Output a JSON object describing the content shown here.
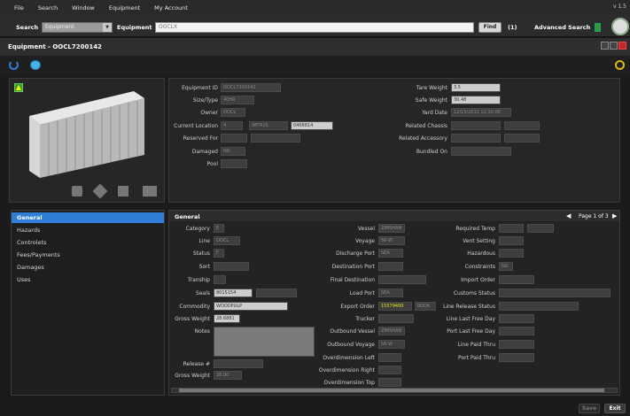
{
  "menu": {
    "items": [
      "File",
      "Search",
      "Window",
      "Equipment",
      "My Account"
    ],
    "version": "v 1.5"
  },
  "search": {
    "label": "Search",
    "type_value": "Equipment",
    "equipment_label": "Equipment",
    "query": "OOCLX",
    "find_label": "Find",
    "count": "(1)",
    "advanced_label": "Advanced Search"
  },
  "panel": {
    "title": "Equipment - OOCL7200142"
  },
  "equipment": {
    "fields": [
      {
        "label": "Equipment ID",
        "value": "OOCL7200142"
      },
      {
        "label": "Size/Type",
        "value": "40HR"
      },
      {
        "label": "Owner",
        "value": "OOCL"
      },
      {
        "label": "Current Location",
        "value": "4",
        "v2": "98TA15",
        "v3": "0468814"
      },
      {
        "label": "Reserved For",
        "value": ""
      },
      {
        "label": "Damaged",
        "value": "NO"
      },
      {
        "label": "Pool",
        "value": ""
      }
    ],
    "right_fields": [
      {
        "label": "Tare Weight",
        "value": "3.5"
      },
      {
        "label": "Safe Weight",
        "value": "30.48"
      },
      {
        "label": "Yard Date",
        "value": "12/15/2013 12:30:00"
      },
      {
        "label": "Related Chassis",
        "value": ""
      },
      {
        "label": "Related Accessory",
        "value": ""
      },
      {
        "label": "Bundled On",
        "value": ""
      }
    ]
  },
  "sidenav": {
    "items": [
      "General",
      "Hazards",
      "Controlets",
      "Fees/Payments",
      "Damages",
      "Uses"
    ]
  },
  "general": {
    "title": "General",
    "page_label": "Page 1 of 3",
    "col1": [
      {
        "label": "Category",
        "value": "E"
      },
      {
        "label": "Line",
        "value": "OOCL"
      },
      {
        "label": "Status",
        "value": "F"
      },
      {
        "label": "Sort",
        "value": ""
      },
      {
        "label": "Tranship",
        "value": ""
      },
      {
        "label": "Seals",
        "value": "8015154"
      },
      {
        "label": "Commodity",
        "value": "WOODPULP"
      },
      {
        "label": "Gross Weight",
        "value": "28.6881"
      },
      {
        "label": "Notes",
        "value": ""
      },
      {
        "label": "Release #",
        "value": ""
      },
      {
        "label": "Gross Weight",
        "value": "28.00"
      }
    ],
    "col2": [
      {
        "label": "Vessel",
        "value": "ZIMSHAN"
      },
      {
        "label": "Voyage",
        "value": "56-W"
      },
      {
        "label": "Discharge Port",
        "value": "SEA"
      },
      {
        "label": "Destination Port",
        "value": ""
      },
      {
        "label": "Final Destination",
        "value": ""
      },
      {
        "label": "Load Port",
        "value": "SEA"
      },
      {
        "label": "Export Order",
        "value": "15579400",
        "v2": "BOOK"
      },
      {
        "label": "Trucker",
        "value": ""
      },
      {
        "label": "Outbound Vessel",
        "value": "ZIMSHAN"
      },
      {
        "label": "Outbound Voyage",
        "value": "56-W"
      },
      {
        "label": "Overdimension Left",
        "value": ""
      },
      {
        "label": "Overdimension Right",
        "value": ""
      },
      {
        "label": "Overdimension Top",
        "value": ""
      }
    ],
    "col3": [
      {
        "label": "Required Temp",
        "value": ""
      },
      {
        "label": "Vent Setting",
        "value": ""
      },
      {
        "label": "Hazardous",
        "value": ""
      },
      {
        "label": "Constraints",
        "value": "NO"
      },
      {
        "label": "Import Order",
        "value": ""
      },
      {
        "label": "Customs Status",
        "value": ""
      },
      {
        "label": "Line Release Status",
        "value": ""
      },
      {
        "label": "Line Last Free Day",
        "value": ""
      },
      {
        "label": "Port Last Free Day",
        "value": ""
      },
      {
        "label": "Line Paid Thru",
        "value": ""
      },
      {
        "label": "Port Paid Thru",
        "value": ""
      }
    ]
  },
  "footer": {
    "save_label": "Save",
    "exit_label": "Exit"
  },
  "colors": {
    "accent": "#2f7fd8",
    "highlight_text": "#e8e800"
  }
}
